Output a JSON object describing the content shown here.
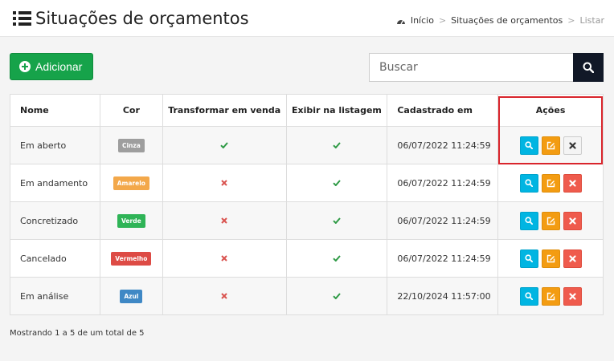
{
  "header": {
    "title": "Situações de orçamentos",
    "breadcrumb": {
      "home": "Início",
      "section": "Situações de orçamentos",
      "current": "Listar",
      "separator": ">"
    }
  },
  "toolbar": {
    "add_label": "Adicionar",
    "search_placeholder": "Buscar"
  },
  "table": {
    "columns": [
      "Nome",
      "Cor",
      "Transformar em venda",
      "Exibir na listagem",
      "Cadastrado em",
      "Ações"
    ],
    "rows": [
      {
        "name": "Em aberto",
        "color_label": "Cinza",
        "color_hex": "#9e9e9e",
        "transform": false,
        "show": true,
        "created": "06/07/2022 11:24:59"
      },
      {
        "name": "Em andamento",
        "color_label": "Amarelo",
        "color_hex": "#f3a84a",
        "transform": false,
        "show": true,
        "created": "06/07/2022 11:24:59"
      },
      {
        "name": "Concretizado",
        "color_label": "Verde",
        "color_hex": "#2fb457",
        "transform": false,
        "show": true,
        "created": "06/07/2022 11:24:59"
      },
      {
        "name": "Cancelado",
        "color_label": "Vermelho",
        "color_hex": "#dd4b45",
        "transform": false,
        "show": true,
        "created": "06/07/2022 11:24:59"
      },
      {
        "name": "Em análise",
        "color_label": "Azul",
        "color_hex": "#3f88c5",
        "transform": false,
        "show": true,
        "created": "22/10/2024 11:57:00"
      }
    ],
    "first_row_overrides": {
      "transform": true
    }
  },
  "footer": {
    "summary": "Mostrando 1 a 5 de um total de 5"
  },
  "colors": {
    "primary_green": "#16a34a",
    "check_green": "#2e9a45",
    "x_red": "#d9534f",
    "view_blue": "#00b5e2",
    "edit_orange": "#f39c12",
    "delete_red": "#ef5b4d",
    "highlight_red": "#d9252c"
  }
}
